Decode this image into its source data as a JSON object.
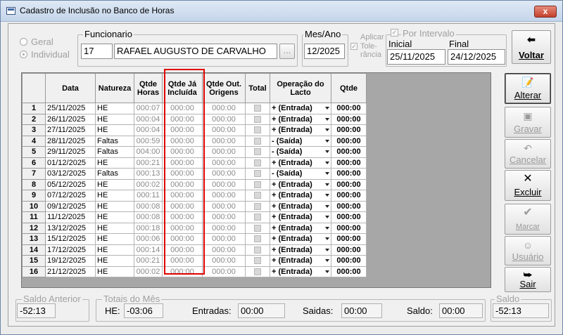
{
  "window": {
    "title": "Cadastro de Inclusão no Banco de Horas",
    "close_label": "x"
  },
  "filter": {
    "geral": "Geral",
    "individual": "Individual"
  },
  "funcionario": {
    "legend": "Funcionario",
    "code": "17",
    "name": "RAFAEL AUGUSTO DE CARVALHO",
    "lookup": "..."
  },
  "mes_ano": {
    "legend": "Mes/Ano",
    "value": "12/2025"
  },
  "aplicar": {
    "line1": "Aplicar",
    "line2": "Tole-",
    "line3": "rância"
  },
  "intervalo": {
    "legend": "Por Intervalo",
    "inicial_label": "Inicial",
    "final_label": "Final",
    "inicial": "25/11/2025",
    "final": "24/12/2025"
  },
  "buttons": {
    "voltar": "Voltar",
    "alterar": "Alterar",
    "gravar": "Gravar",
    "cancelar": "Cancelar",
    "excluir": "Excluir",
    "marcar": "Marcar",
    "usuario": "Usuário",
    "sair": "Sair"
  },
  "icons": {
    "voltar": "back-arrow-icon",
    "alterar": "edit-icon",
    "gravar": "save-icon",
    "cancelar": "undo-icon",
    "excluir": "delete-x-icon",
    "marcar": "checkmark-icon",
    "usuario": "user-icon",
    "sair": "exit-door-icon"
  },
  "grid": {
    "headers": {
      "data": "Data",
      "natureza": "Natureza",
      "qtde_horas_1": "Qtde",
      "qtde_horas_2": "Horas",
      "qtde_ja_1": "Qtde Já",
      "qtde_ja_2": "Incluída",
      "qtde_out_1": "Qtde Out.",
      "qtde_out_2": "Origens",
      "total": "Total",
      "operacao_1": "Operação do",
      "operacao_2": "Lacto",
      "qtde": "Qtde"
    },
    "rows": [
      {
        "n": "1",
        "data": "25/11/2025",
        "natureza": "HE",
        "horas": "000:07",
        "ja": "000:00",
        "out": "000:00",
        "op": "+ (Entrada)",
        "qtde": "000:00"
      },
      {
        "n": "2",
        "data": "26/11/2025",
        "natureza": "HE",
        "horas": "000:04",
        "ja": "000:00",
        "out": "000:00",
        "op": "+ (Entrada)",
        "qtde": "000:00"
      },
      {
        "n": "3",
        "data": "27/11/2025",
        "natureza": "HE",
        "horas": "000:04",
        "ja": "000:00",
        "out": "000:00",
        "op": "+ (Entrada)",
        "qtde": "000:00"
      },
      {
        "n": "4",
        "data": "28/11/2025",
        "natureza": "Faltas",
        "horas": "000:59",
        "ja": "000:00",
        "out": "000:00",
        "op": "- (Saída)",
        "qtde": "000:00"
      },
      {
        "n": "5",
        "data": "29/11/2025",
        "natureza": "Faltas",
        "horas": "004:00",
        "ja": "000:00",
        "out": "000:00",
        "op": "- (Saída)",
        "qtde": "000:00"
      },
      {
        "n": "6",
        "data": "01/12/2025",
        "natureza": "HE",
        "horas": "000:21",
        "ja": "000:00",
        "out": "000:00",
        "op": "+ (Entrada)",
        "qtde": "000:00"
      },
      {
        "n": "7",
        "data": "03/12/2025",
        "natureza": "Faltas",
        "horas": "000:13",
        "ja": "000:00",
        "out": "000:00",
        "op": "- (Saída)",
        "qtde": "000:00"
      },
      {
        "n": "8",
        "data": "05/12/2025",
        "natureza": "HE",
        "horas": "000:02",
        "ja": "000:00",
        "out": "000:00",
        "op": "+ (Entrada)",
        "qtde": "000:00"
      },
      {
        "n": "9",
        "data": "07/12/2025",
        "natureza": "HE",
        "horas": "000:11",
        "ja": "000:00",
        "out": "000:00",
        "op": "+ (Entrada)",
        "qtde": "000:00"
      },
      {
        "n": "10",
        "data": "09/12/2025",
        "natureza": "HE",
        "horas": "000:08",
        "ja": "000:00",
        "out": "000:00",
        "op": "+ (Entrada)",
        "qtde": "000:00"
      },
      {
        "n": "11",
        "data": "11/12/2025",
        "natureza": "HE",
        "horas": "000:08",
        "ja": "000:00",
        "out": "000:00",
        "op": "+ (Entrada)",
        "qtde": "000:00"
      },
      {
        "n": "12",
        "data": "13/12/2025",
        "natureza": "HE",
        "horas": "000:18",
        "ja": "000:00",
        "out": "000:00",
        "op": "+ (Entrada)",
        "qtde": "000:00"
      },
      {
        "n": "13",
        "data": "15/12/2025",
        "natureza": "HE",
        "horas": "000:06",
        "ja": "000:00",
        "out": "000:00",
        "op": "+ (Entrada)",
        "qtde": "000:00"
      },
      {
        "n": "14",
        "data": "17/12/2025",
        "natureza": "HE",
        "horas": "000:14",
        "ja": "000:00",
        "out": "000:00",
        "op": "+ (Entrada)",
        "qtde": "000:00"
      },
      {
        "n": "15",
        "data": "19/12/2025",
        "natureza": "HE",
        "horas": "000:21",
        "ja": "000:00",
        "out": "000:00",
        "op": "+ (Entrada)",
        "qtde": "000:00"
      },
      {
        "n": "16",
        "data": "21/12/2025",
        "natureza": "HE",
        "horas": "000:02",
        "ja": "000:00",
        "out": "000:00",
        "op": "+ (Entrada)",
        "qtde": "000:00"
      }
    ]
  },
  "footer": {
    "saldo_anterior_legend": "Saldo Anterior",
    "saldo_anterior": "-52:13",
    "totais_legend": "Totais do Mês",
    "he_label": "HE:",
    "he_value": "-03:06",
    "entradas_label": "Entradas:",
    "entradas_value": "00:00",
    "saidas_label": "Saidas:",
    "saidas_value": "00:00",
    "saldo_label": "Saldo:",
    "saldo_value": "00:00",
    "saldo_legend": "Saldo",
    "saldo_final": "-52:13"
  },
  "colors": {
    "highlight": "#e00000",
    "close": "#c4412b",
    "grid_bg": "#a7a7a7"
  }
}
